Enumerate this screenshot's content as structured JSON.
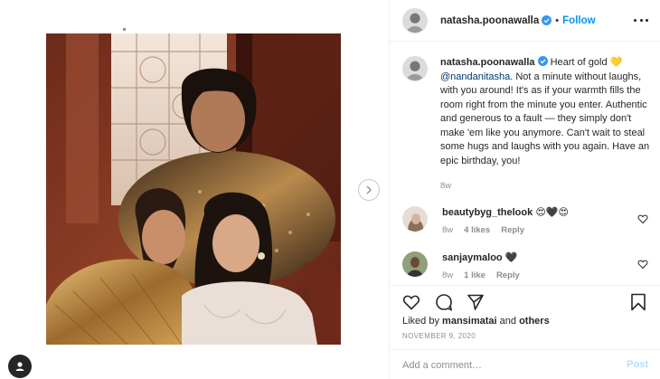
{
  "post": {
    "username": "natasha.poonawalla",
    "follow_label": "Follow",
    "separator": "•",
    "caption": {
      "username": "natasha.poonawalla",
      "part1": "Heart of gold",
      "emoji": "💛",
      "mention": "@nandanitasha",
      "part2": ". Not a minute without laughs, with you around! It's as if your warmth fills the room right from the minute you enter. Authentic and generous to a fault — they simply don't make 'em like you anymore. Can't wait to steal some hugs and laughs with you again. Have an epic birthday, you!",
      "time": "8w"
    },
    "comments": [
      {
        "username": "beautybyg_thelook",
        "text": "😍🖤😍",
        "time": "8w",
        "likes": "4 likes",
        "reply": "Reply"
      },
      {
        "username": "sanjaymaloo",
        "text": "🖤",
        "time": "8w",
        "likes": "1 like",
        "reply": "Reply"
      }
    ],
    "liked_by_prefix": "Liked by",
    "liked_by_user": "mansimatai",
    "liked_by_and": "and",
    "liked_by_others": "others",
    "date": "NOVEMBER 9, 2020",
    "add_comment_placeholder": "Add a comment…",
    "post_label": "Post"
  },
  "icons": {
    "verified": "verified-badge-icon",
    "more": "more-options-icon",
    "like": "heart-outline-icon",
    "comment": "comment-bubble-icon",
    "share": "paper-plane-icon",
    "save": "bookmark-icon",
    "next": "chevron-right-icon",
    "fab": "user-icon"
  },
  "colors": {
    "accent": "#0095f6",
    "text": "#262626",
    "muted": "#8e8e8e",
    "border": "#efefef",
    "post_disabled": "#b2dffc"
  }
}
